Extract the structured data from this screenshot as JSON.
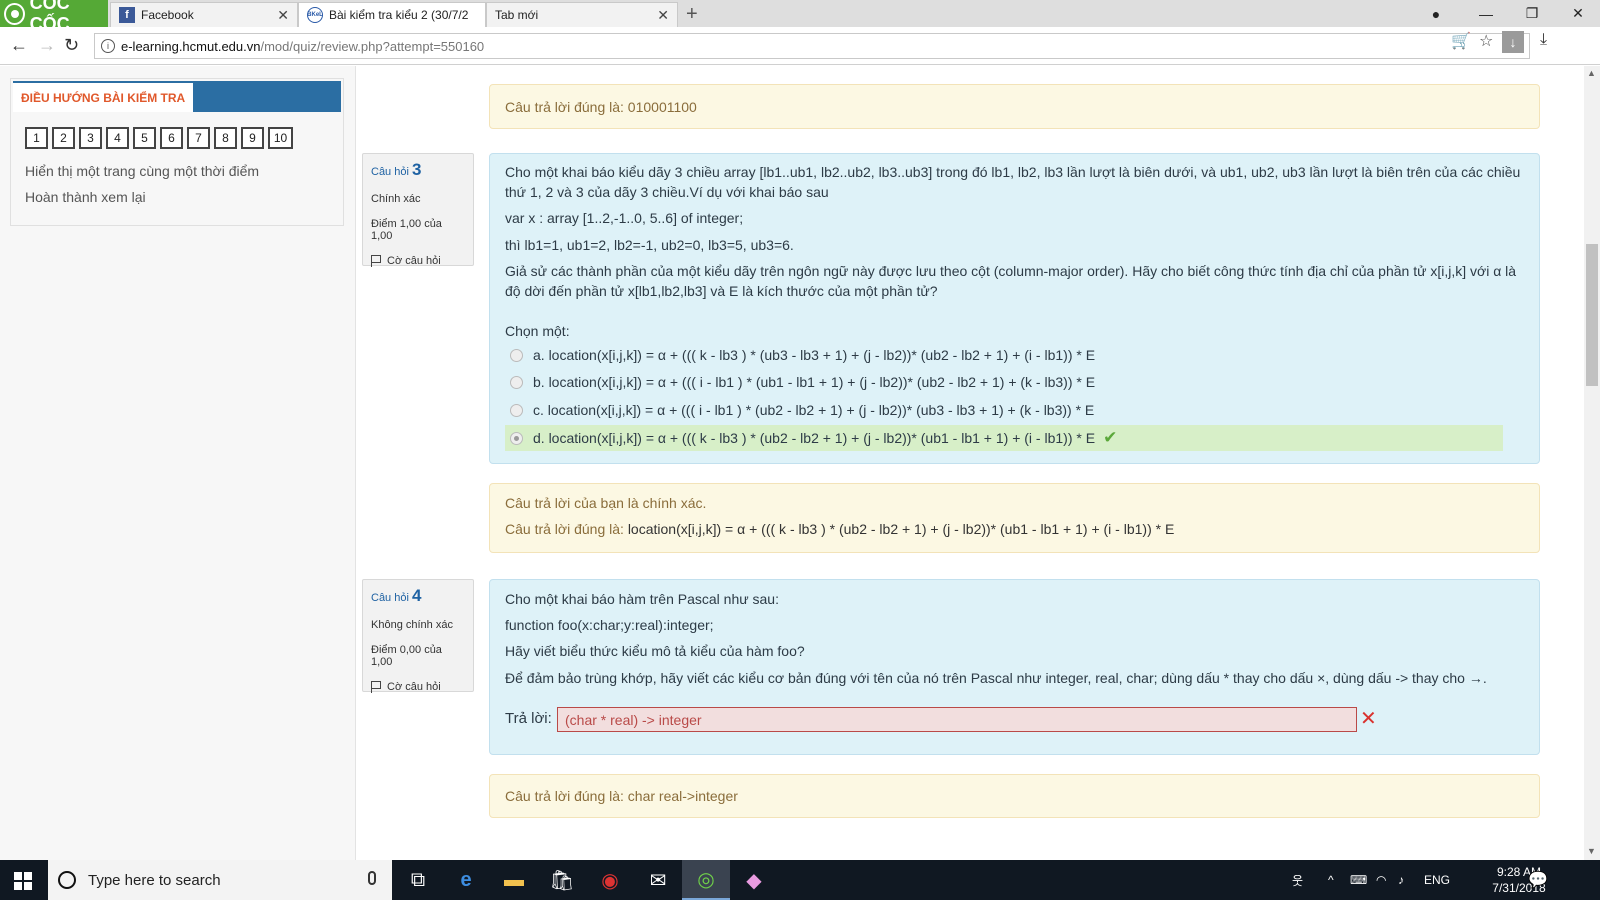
{
  "browser": {
    "brand": "CỐC CỐC",
    "tabs": [
      {
        "label": "Facebook",
        "icon": "facebook-icon"
      },
      {
        "label": "Bài kiểm tra kiểu 2 (30/7/2",
        "icon": "bkel-icon"
      },
      {
        "label": "Tab mới",
        "icon": ""
      }
    ],
    "address": {
      "host": "e-learning.hcmut.edu.vn",
      "path": "/mod/quiz/review.php?attempt=550160"
    }
  },
  "sidebar": {
    "title": "ĐIỀU HƯỚNG BÀI KIỂM TRA",
    "question_numbers": [
      "1",
      "2",
      "3",
      "4",
      "5",
      "6",
      "7",
      "8",
      "9",
      "10"
    ],
    "links": [
      "Hiển thị một trang cùng một thời điểm",
      "Hoàn thành xem lại"
    ]
  },
  "prev_answer": {
    "correct_answer": "Câu trả lời đúng là: 010001100"
  },
  "q3": {
    "label": "Câu hỏi",
    "number": "3",
    "status": "Chính xác",
    "grade": "Điểm 1,00 của 1,00",
    "flag": "Cờ câu hỏi",
    "text": [
      "Cho một khai báo kiểu dãy 3 chiều array [lb1..ub1, lb2..ub2, lb3..ub3] trong đó lb1, lb2, lb3 lần lượt là biên dưới, và ub1, ub2, ub3 lần lượt là biên trên của các chiều",
      "thứ 1, 2 và 3 của dãy 3 chiều.Ví dụ với khai báo sau",
      "var x : array [1..2,-1..0, 5..6] of integer;",
      "thì lb1=1, ub1=2, lb2=-1, ub2=0, lb3=5, ub3=6.",
      "Giả sử các thành phần của một kiểu dãy trên ngôn ngữ này được lưu theo cột (column-major order). Hãy cho biết công thức tính địa chỉ của phần tử x[i,j,k] với α là",
      "độ dời đến phần tử x[lb1,lb2,lb3] và E là kích thước của một phần tử?"
    ],
    "prompt": "Chọn một:",
    "options": [
      "a. location(x[i,j,k]) = α + ((( k - lb3 ) * (ub3 - lb3 + 1) + (j - lb2))* (ub2 - lb2 + 1) + (i - lb1)) * E",
      "b. location(x[i,j,k]) = α + ((( i - lb1 ) * (ub1 - lb1 + 1) + (j - lb2))* (ub2 - lb2 + 1) + (k - lb3)) * E",
      "c. location(x[i,j,k]) = α + ((( i - lb1 ) * (ub2 - lb2 + 1) + (j - lb2))* (ub3 - lb3 + 1) + (k - lb3)) * E",
      "d. location(x[i,j,k]) = α + ((( k - lb3 ) * (ub2 - lb2 + 1) + (j - lb2))* (ub1 - lb1 + 1) + (i - lb1)) * E"
    ],
    "feedback_correct": "Câu trả lời của bạn là chính xác.",
    "feedback_label": "Câu trả lời đúng là: ",
    "feedback_answer": "location(x[i,j,k]) = α + ((( k - lb3 ) * (ub2 - lb2 + 1) + (j - lb2))* (ub1 - lb1 + 1) + (i - lb1)) * E"
  },
  "q4": {
    "label": "Câu hỏi",
    "number": "4",
    "status": "Không chính xác",
    "grade": "Điểm 0,00 của 1,00",
    "flag": "Cờ câu hỏi",
    "text": [
      "Cho một khai báo hàm trên Pascal như sau:",
      "function foo(x:char;y:real):integer;",
      "Hãy viết biểu thức kiểu mô tả kiểu của hàm foo?",
      "Để đảm bảo trùng khớp, hãy viết các kiểu cơ bản đúng với tên của nó trên Pascal như integer, real, char; dùng dấu * thay cho dấu ×, dùng dấu -> thay cho →."
    ],
    "answer_label": "Trả lời:",
    "answer_value": "(char * real) -> integer",
    "correct_answer": "Câu trả lời đúng là: char real->integer"
  },
  "taskbar": {
    "search_placeholder": "Type here to search",
    "language": "ENG",
    "time": "9:28 AM",
    "date": "7/31/2018"
  }
}
